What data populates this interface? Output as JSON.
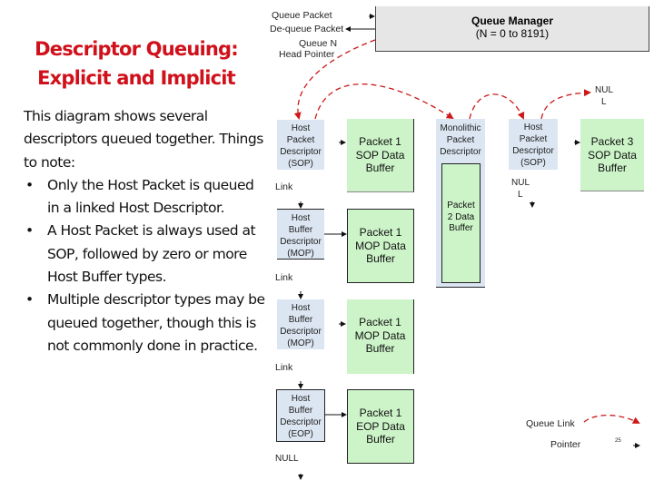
{
  "title": {
    "line1": "Descriptor Queuing:",
    "line2": "Explicit and Implicit"
  },
  "body": {
    "intro": "This diagram shows several descriptors queued together. Things to note:",
    "bullet_glyph": "•",
    "bullets": [
      "Only the Host Packet is queued in a linked Host Descriptor.",
      "A Host Packet is always used at SOP, followed by zero or more Host Buffer types.",
      "Multiple descriptor types may be queued together, though this is not commonly done in practice."
    ]
  },
  "diagram": {
    "queue_manager": {
      "title": "Queue Manager",
      "subtitle": "(N = 0 to 8191)"
    },
    "labels": {
      "queue_packet": "Queue Packet",
      "dequeue_packet": "De-queue Packet",
      "head_pointer_line1": "Queue N",
      "head_pointer_line2": "Head Pointer",
      "null_top_line1": "NUL",
      "null_top_line2": "L",
      "null_mid_line1": "NUL",
      "null_mid_line2": "L",
      "null_bottom": "NULL",
      "link1": "Link",
      "link2": "Link",
      "link3": "Link"
    },
    "descriptors": [
      {
        "lines": [
          "Host",
          "Packet",
          "Descriptor",
          "(SOP)"
        ]
      },
      {
        "lines": [
          "Host",
          "Buffer",
          "Descriptor",
          "(MOP)"
        ]
      },
      {
        "lines": [
          "Host",
          "Buffer",
          "Descriptor",
          "(MOP)"
        ]
      },
      {
        "lines": [
          "Host",
          "Buffer",
          "Descriptor",
          "(EOP)"
        ]
      },
      {
        "lines": [
          "Monolithic",
          "Packet",
          "Descriptor"
        ]
      },
      {
        "lines": [
          "Host",
          "Packet",
          "Descriptor",
          "(SOP)"
        ]
      }
    ],
    "buffers": [
      {
        "lines": [
          "Packet 1",
          "SOP Data",
          "Buffer"
        ]
      },
      {
        "lines": [
          "Packet 1",
          "MOP Data",
          "Buffer"
        ]
      },
      {
        "lines": [
          "Packet 1",
          "MOP Data",
          "Buffer"
        ]
      },
      {
        "lines": [
          "Packet 1",
          "EOP Data",
          "Buffer"
        ]
      },
      {
        "lines": [
          "Packet",
          "2 Data",
          "Buffer"
        ]
      },
      {
        "lines": [
          "Packet 3",
          "SOP Data",
          "Buffer"
        ]
      }
    ],
    "legend": {
      "queue_link": "Queue Link",
      "pointer": "Pointer"
    },
    "colors": {
      "queue_link": "#cc1a1a",
      "descriptor_fill": "#dce6f2",
      "buffer_fill": "#ccf4c8",
      "queue_manager_fill": "#e6e6e6",
      "title": "#d0101a"
    }
  },
  "page_number": "25"
}
